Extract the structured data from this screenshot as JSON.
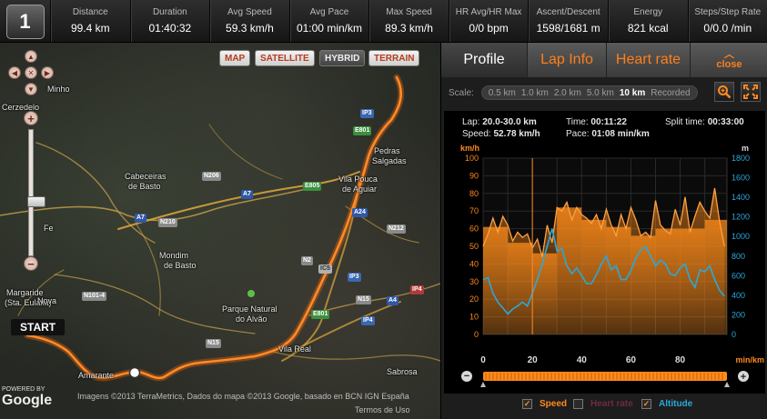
{
  "lap": "1",
  "stats": [
    {
      "label": "Distance",
      "value": "99.4 km"
    },
    {
      "label": "Duration",
      "value": "01:40:32"
    },
    {
      "label": "Avg Speed",
      "value": "59.3 km/h"
    },
    {
      "label": "Avg Pace",
      "value": "01:00 min/km"
    },
    {
      "label": "Max Speed",
      "value": "89.3 km/h"
    },
    {
      "label": "HR Avg/HR Max",
      "value": "0/0 bpm"
    },
    {
      "label": "Ascent/Descent",
      "value": "1598/1681 m"
    },
    {
      "label": "Energy",
      "value": "821 kcal"
    },
    {
      "label": "Steps/Step Rate",
      "value": "0/0.0 /min"
    }
  ],
  "map": {
    "types": [
      "MAP",
      "SATELLITE",
      "HYBRID",
      "TERRAIN"
    ],
    "active_type": "HYBRID",
    "start_label": "START",
    "copyright": "Imagens ©2013 TerraMetrics, Dados do mapa ©2013 Google, basado en BCN IGN España",
    "copyright2": "Termos de Uso",
    "powered_by": "POWERED BY",
    "google": "Google",
    "places": [
      {
        "t": "Minho"
      },
      {
        "t": "Cerzedelo"
      },
      {
        "t": "Cabeceiras"
      },
      {
        "t": "de Basto"
      },
      {
        "t": "Vila Pouca"
      },
      {
        "t": "de Aguiar"
      },
      {
        "t": "Pedras"
      },
      {
        "t": "Salgadas"
      },
      {
        "t": "Mondim"
      },
      {
        "t": "de Basto"
      },
      {
        "t": "Margaride"
      },
      {
        "t": "(Sta. Eulália)"
      },
      {
        "t": "Parque Natural"
      },
      {
        "t": "do Alvão"
      },
      {
        "t": "Vila Real"
      },
      {
        "t": "Amarante"
      },
      {
        "t": "Sabrosa"
      },
      {
        "t": "Nova"
      },
      {
        "t": "Fe"
      }
    ],
    "shields": [
      {
        "t": "IP3",
        "c": "sh-ip"
      },
      {
        "t": "E801",
        "c": "sh-e"
      },
      {
        "t": "N206",
        "c": "sh-n"
      },
      {
        "t": "A7",
        "c": "sh-a"
      },
      {
        "t": "E805",
        "c": "sh-e"
      },
      {
        "t": "A7",
        "c": "sh-a"
      },
      {
        "t": "N210",
        "c": "sh-n"
      },
      {
        "t": "A24",
        "c": "sh-a"
      },
      {
        "t": "N212",
        "c": "sh-n"
      },
      {
        "t": "N2",
        "c": "sh-n"
      },
      {
        "t": "IC5",
        "c": "sh-ic"
      },
      {
        "t": "N101-4",
        "c": "sh-n"
      },
      {
        "t": "IP3",
        "c": "sh-ip"
      },
      {
        "t": "N15",
        "c": "sh-n"
      },
      {
        "t": "A4",
        "c": "sh-a"
      },
      {
        "t": "IP4",
        "c": "sh-red"
      },
      {
        "t": "E801",
        "c": "sh-e"
      },
      {
        "t": "IP4",
        "c": "sh-ip"
      },
      {
        "t": "N15",
        "c": "sh-n"
      }
    ]
  },
  "panel": {
    "tabs": [
      "Profile",
      "Lap Info",
      "Heart rate"
    ],
    "close_label": "close",
    "scale_label": "Scale:",
    "scales": [
      "0.5 km",
      "1.0 km",
      "2.0 km",
      "5.0 km",
      "10 km",
      "Recorded"
    ],
    "active_scale": "10 km",
    "info": {
      "lap_label": "Lap:",
      "lap_value": "20.0-30.0 km",
      "time_label": "Time:",
      "time_value": "00:11:22",
      "split_label": "Split time:",
      "split_value": "00:33:00",
      "speed_label": "Speed:",
      "speed_value": "52.78 km/h",
      "pace_label": "Pace:",
      "pace_value": "01:08 min/km"
    },
    "legend": [
      {
        "label": "Speed",
        "checked": true,
        "color": "#ff8a1f"
      },
      {
        "label": "Heart rate",
        "checked": false,
        "color": "#7a2a4a"
      },
      {
        "label": "Altitude",
        "checked": true,
        "color": "#2aa8dc"
      }
    ],
    "unit_left": "km/h",
    "unit_right": "m",
    "unit_bottom": "min/km"
  },
  "chart_data": {
    "type": "line",
    "xlabel": "min/km",
    "x_ticks": [
      0,
      20,
      40,
      60,
      80
    ],
    "xlim": [
      0,
      99
    ],
    "ylim_left": [
      0,
      100
    ],
    "yticks_left": [
      0,
      10,
      20,
      30,
      40,
      50,
      60,
      70,
      80,
      90,
      100
    ],
    "ylabel_left": "km/h",
    "ylim_right": [
      0,
      1800
    ],
    "yticks_right": [
      0,
      200,
      400,
      600,
      800,
      1000,
      1200,
      1400,
      1600,
      1800
    ],
    "ylabel_right": "m",
    "cursor_x": 20,
    "laps_speed": [
      {
        "x0": 0,
        "x1": 10,
        "v": 61
      },
      {
        "x0": 10,
        "x1": 20,
        "v": 52
      },
      {
        "x0": 20,
        "x1": 30,
        "v": 46
      },
      {
        "x0": 30,
        "x1": 40,
        "v": 72
      },
      {
        "x0": 40,
        "x1": 50,
        "v": 65
      },
      {
        "x0": 50,
        "x1": 60,
        "v": 61
      },
      {
        "x0": 60,
        "x1": 70,
        "v": 56
      },
      {
        "x0": 70,
        "x1": 80,
        "v": 60
      },
      {
        "x0": 80,
        "x1": 90,
        "v": 60
      },
      {
        "x0": 90,
        "x1": 99,
        "v": 65
      }
    ],
    "series": [
      {
        "name": "Speed",
        "axis": "left",
        "x": [
          0,
          2,
          4,
          6,
          8,
          10,
          12,
          14,
          16,
          18,
          20,
          22,
          24,
          26,
          28,
          30,
          32,
          34,
          36,
          38,
          40,
          42,
          44,
          46,
          48,
          50,
          52,
          54,
          56,
          58,
          60,
          62,
          64,
          66,
          68,
          70,
          72,
          74,
          76,
          78,
          80,
          82,
          84,
          86,
          88,
          90,
          92,
          94,
          96,
          98
        ],
        "y": [
          50,
          57,
          66,
          58,
          67,
          62,
          53,
          58,
          55,
          57,
          49,
          54,
          44,
          62,
          52,
          72,
          70,
          75,
          65,
          72,
          68,
          66,
          63,
          68,
          60,
          71,
          62,
          56,
          68,
          60,
          72,
          65,
          56,
          58,
          55,
          76,
          62,
          59,
          57,
          71,
          62,
          78,
          58,
          67,
          75,
          70,
          66,
          83,
          64,
          50
        ]
      },
      {
        "name": "Altitude",
        "axis": "right",
        "x": [
          0,
          2,
          4,
          6,
          8,
          10,
          12,
          14,
          16,
          18,
          20,
          22,
          24,
          26,
          28,
          30,
          32,
          34,
          36,
          38,
          40,
          42,
          44,
          46,
          48,
          50,
          52,
          54,
          56,
          58,
          60,
          62,
          64,
          66,
          68,
          70,
          72,
          74,
          76,
          78,
          80,
          82,
          84,
          86,
          88,
          90,
          92,
          94,
          96,
          98
        ],
        "y": [
          560,
          580,
          420,
          330,
          270,
          210,
          260,
          290,
          330,
          290,
          420,
          560,
          720,
          900,
          1080,
          850,
          880,
          700,
          620,
          680,
          600,
          520,
          520,
          610,
          720,
          800,
          660,
          700,
          560,
          560,
          650,
          780,
          860,
          900,
          800,
          700,
          760,
          720,
          620,
          600,
          680,
          720,
          560,
          480,
          660,
          640,
          700,
          560,
          450,
          390
        ]
      }
    ]
  }
}
